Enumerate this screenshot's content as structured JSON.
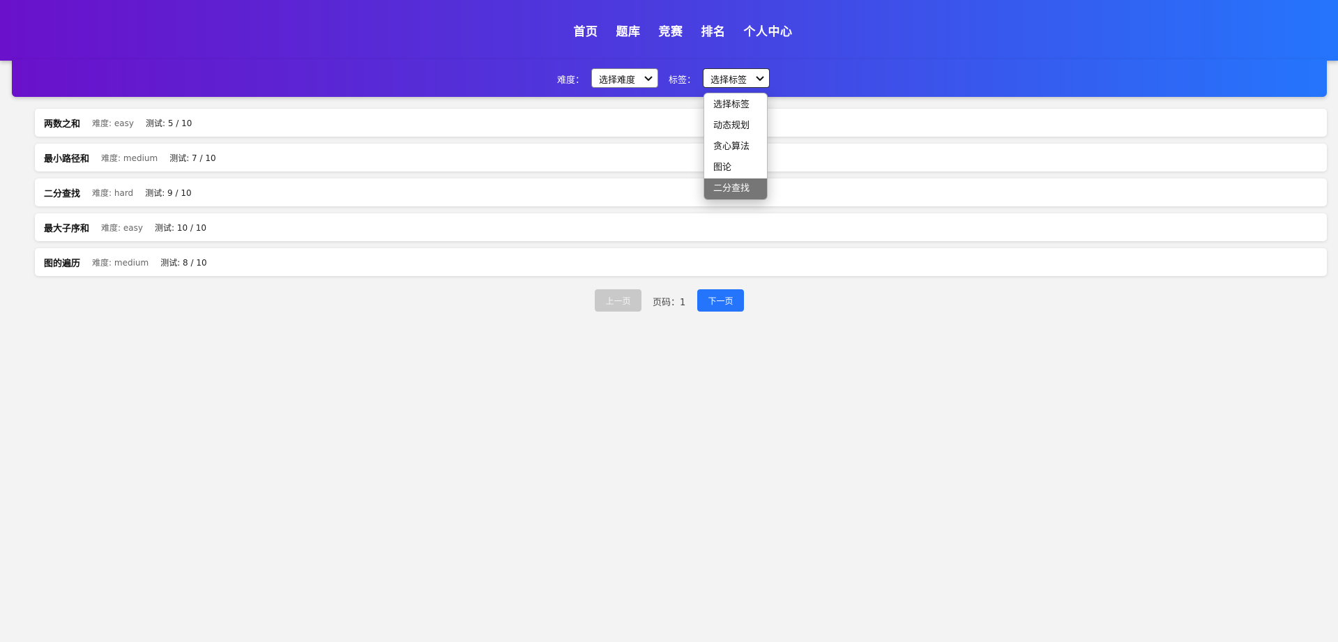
{
  "nav": {
    "items": [
      "首页",
      "题库",
      "竞赛",
      "排名",
      "个人中心"
    ]
  },
  "filters": {
    "difficulty_label": "难度：",
    "difficulty_selected": "选择难度",
    "tag_label": "标签：",
    "tag_selected": "选择标签",
    "tag_options": [
      "选择标签",
      "动态规划",
      "贪心算法",
      "图论",
      "二分查找"
    ],
    "tag_highlighted": "二分查找"
  },
  "problems": [
    {
      "title": "两数之和",
      "difficulty": "难度: easy",
      "tests": "测试: 5 / 10"
    },
    {
      "title": "最小路径和",
      "difficulty": "难度: medium",
      "tests": "测试: 7 / 10"
    },
    {
      "title": "二分查找",
      "difficulty": "难度: hard",
      "tests": "测试: 9 / 10"
    },
    {
      "title": "最大子序和",
      "difficulty": "难度: easy",
      "tests": "测试: 10 / 10"
    },
    {
      "title": "图的遍历",
      "difficulty": "难度: medium",
      "tests": "测试: 8 / 10"
    }
  ],
  "pagination": {
    "prev_label": "上一页",
    "page_info": "页码：1",
    "next_label": "下一页"
  },
  "colors": {
    "gradient_start": "#6a11cb",
    "gradient_end": "#2575fc",
    "primary_button": "#2575fc",
    "disabled_button": "#c9c9c9",
    "highlight_option": "#767676"
  }
}
